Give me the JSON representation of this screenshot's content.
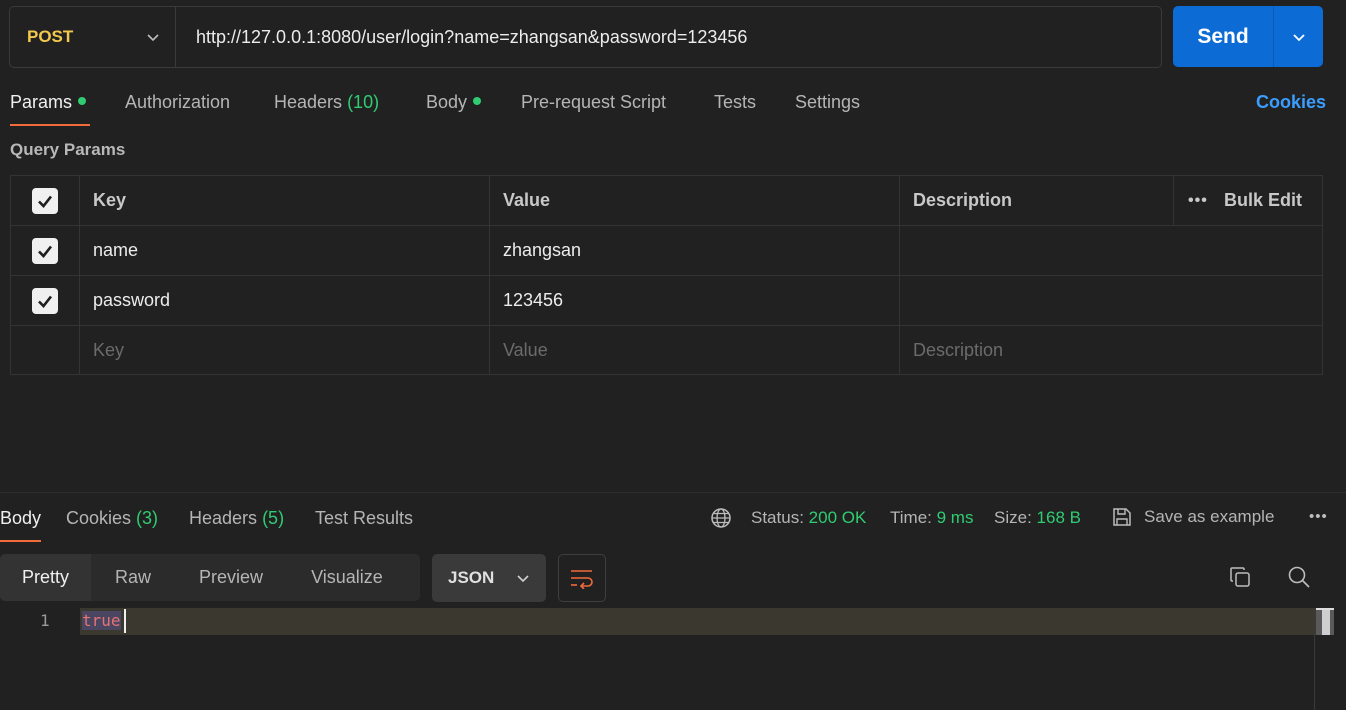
{
  "request": {
    "method": "POST",
    "url": "http://127.0.0.1:8080/user/login?name=zhangsan&password=123456",
    "send_label": "Send"
  },
  "req_tabs": {
    "params": "Params",
    "authorization": "Authorization",
    "headers": "Headers",
    "headers_count": "(10)",
    "body": "Body",
    "pre_request": "Pre-request Script",
    "tests": "Tests",
    "settings": "Settings",
    "cookies": "Cookies"
  },
  "query_params": {
    "title": "Query Params",
    "columns": {
      "key": "Key",
      "value": "Value",
      "description": "Description"
    },
    "bulk_edit": "Bulk Edit",
    "rows": [
      {
        "key": "name",
        "value": "zhangsan",
        "description": "",
        "checked": true
      },
      {
        "key": "password",
        "value": "123456",
        "description": "",
        "checked": true
      }
    ],
    "placeholder": {
      "key": "Key",
      "value": "Value",
      "description": "Description"
    }
  },
  "response": {
    "tabs": {
      "body": "Body",
      "cookies": "Cookies",
      "cookies_count": "(3)",
      "headers": "Headers",
      "headers_count": "(5)",
      "test_results": "Test Results"
    },
    "status_label": "Status:",
    "status_value": "200 OK",
    "time_label": "Time:",
    "time_value": "9 ms",
    "size_label": "Size:",
    "size_value": "168 B",
    "save_example": "Save as example",
    "views": [
      "Pretty",
      "Raw",
      "Preview",
      "Visualize"
    ],
    "format": "JSON",
    "line_number": "1",
    "code": "true"
  },
  "colors": {
    "accent_orange": "#f26b3a",
    "send_blue": "#0d6bd6",
    "success_green": "#2fcc71",
    "method_yellow": "#f2c94c",
    "link_blue": "#3b9eff"
  }
}
